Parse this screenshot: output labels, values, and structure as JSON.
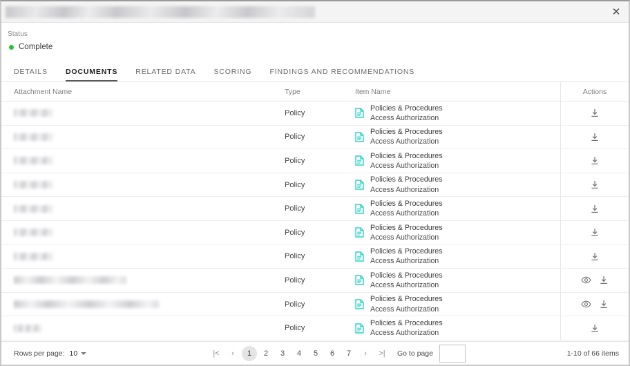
{
  "window": {
    "title_redacted": true,
    "close_label": "✕"
  },
  "status": {
    "label": "Status",
    "value": "Complete",
    "dot_color": "#27c23f"
  },
  "tabs": [
    {
      "label": "DETAILS",
      "active": false
    },
    {
      "label": "DOCUMENTS",
      "active": true
    },
    {
      "label": "RELATED DATA",
      "active": false
    },
    {
      "label": "SCORING",
      "active": false
    },
    {
      "label": "FINDINGS AND RECOMMENDATIONS",
      "active": false
    }
  ],
  "table": {
    "columns": {
      "attachment_name": "Attachment Name",
      "type": "Type",
      "item_name": "Item Name",
      "actions": "Actions"
    },
    "rows": [
      {
        "attachment_name": "",
        "redacted_width": 56,
        "type": "Policy",
        "item_title": "Policies & Procedures",
        "item_sub": "Access Authorization",
        "actions": [
          "download-icon"
        ]
      },
      {
        "attachment_name": "",
        "redacted_width": 56,
        "type": "Policy",
        "item_title": "Policies & Procedures",
        "item_sub": "Access Authorization",
        "actions": [
          "download-icon"
        ]
      },
      {
        "attachment_name": "",
        "redacted_width": 56,
        "type": "Policy",
        "item_title": "Policies & Procedures",
        "item_sub": "Access Authorization",
        "actions": [
          "download-icon"
        ]
      },
      {
        "attachment_name": "",
        "redacted_width": 56,
        "type": "Policy",
        "item_title": "Policies & Procedures",
        "item_sub": "Access Authorization",
        "actions": [
          "download-icon"
        ]
      },
      {
        "attachment_name": "",
        "redacted_width": 56,
        "type": "Policy",
        "item_title": "Policies & Procedures",
        "item_sub": "Access Authorization",
        "actions": [
          "download-icon"
        ]
      },
      {
        "attachment_name": "",
        "redacted_width": 56,
        "type": "Policy",
        "item_title": "Policies & Procedures",
        "item_sub": "Access Authorization",
        "actions": [
          "download-icon"
        ]
      },
      {
        "attachment_name": "",
        "redacted_width": 56,
        "type": "Policy",
        "item_title": "Policies & Procedures",
        "item_sub": "Access Authorization",
        "actions": [
          "download-icon"
        ]
      },
      {
        "attachment_name": "",
        "redacted_width": 163,
        "type": "Policy",
        "item_title": "Policies & Procedures",
        "item_sub": "Access Authorization",
        "actions": [
          "preview-icon",
          "download-icon"
        ]
      },
      {
        "attachment_name": "",
        "redacted_width": 210,
        "type": "Policy",
        "item_title": "Policies & Procedures",
        "item_sub": "Access Authorization",
        "actions": [
          "preview-icon",
          "download-icon"
        ]
      },
      {
        "attachment_name": "",
        "redacted_width": 40,
        "type": "Policy",
        "item_title": "Policies & Procedures",
        "item_sub": "Access Authorization",
        "actions": [
          "download-icon"
        ]
      }
    ]
  },
  "footer": {
    "rows_per_page_label": "Rows per page:",
    "rows_per_page_value": "10",
    "pagination": {
      "first_label": "|<",
      "prev_label": "‹",
      "pages": [
        "1",
        "2",
        "3",
        "4",
        "5",
        "6",
        "7"
      ],
      "active_page": "1",
      "next_label": "›",
      "last_label": ">|"
    },
    "goto_label": "Go to page",
    "goto_value": "",
    "goto_placeholder": "",
    "item_count": "1-10 of 66 items"
  },
  "colors": {
    "doc_icon": "#2ad4c4",
    "status_green": "#27c23f",
    "accent_underline": "#585858"
  }
}
